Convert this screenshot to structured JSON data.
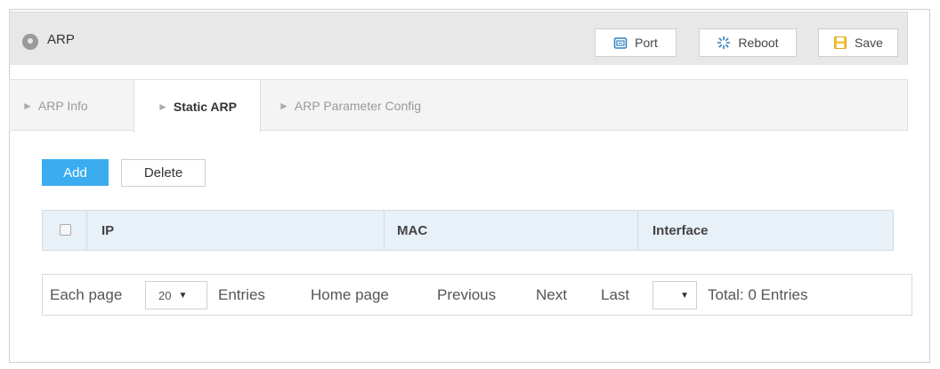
{
  "header": {
    "title": "ARP",
    "buttons": {
      "port": "Port",
      "reboot": "Reboot",
      "save": "Save"
    }
  },
  "tabs": [
    {
      "label": "ARP Info"
    },
    {
      "label": "Static ARP"
    },
    {
      "label": "ARP Parameter Config"
    }
  ],
  "toolbar": {
    "add": "Add",
    "delete": "Delete"
  },
  "table": {
    "columns": [
      "IP",
      "MAC",
      "Interface"
    ]
  },
  "pager": {
    "each_page": "Each page",
    "page_size": "20",
    "entries": "Entries",
    "home": "Home page",
    "previous": "Previous",
    "next": "Next",
    "last": "Last",
    "page_select": "",
    "total": "Total: 0 Entries"
  },
  "colors": {
    "accent": "#3badef",
    "header_bg": "#e8e8e8",
    "table_header_bg": "#e8f0f8"
  }
}
